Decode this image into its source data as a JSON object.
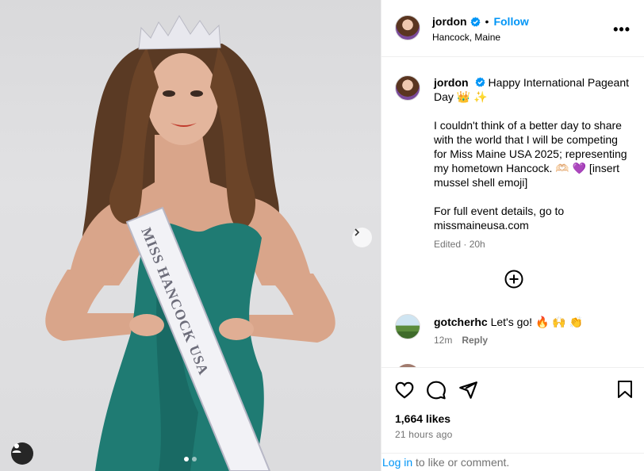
{
  "post": {
    "username": "jordon",
    "follow_label": "Follow",
    "separator": "•",
    "location": "Hancock, Maine",
    "more_label": "•••",
    "caption": {
      "line1": "Happy International Pageant Day 👑 ✨",
      "paragraph2": "I couldn't think of a better day to share with the world that I will be competing for Miss Maine USA 2025; representing my hometown Hancock. 🫶🏻 💜 [insert mussel shell emoji]",
      "paragraph3": "For full event details, go to missmaineusa.com"
    },
    "caption_meta": "Edited · 20h",
    "photo": {
      "sash_text": "MISS HANCOCK USA",
      "carousel_total": 2,
      "carousel_current": 1
    }
  },
  "comments": [
    {
      "username": "gotcherhc",
      "text": "Let's go! 🔥 🙌 👏",
      "time": "12m",
      "reply_label": "Reply"
    }
  ],
  "engagement": {
    "likes": "1,664 likes",
    "time_ago": "21 hours ago"
  },
  "login": {
    "link_label": "Log in",
    "text": " to like or comment."
  },
  "icons": {
    "verified": "verified-badge-icon",
    "like": "heart-icon",
    "comment": "comment-bubble-icon",
    "share": "paper-plane-icon",
    "save": "bookmark-icon",
    "add_comment": "plus-circle-icon",
    "carousel_next": "chevron-right-icon",
    "tagged": "user-tag-icon"
  },
  "colors": {
    "accent": "#0095f6",
    "verified": "#0095f6",
    "muted_text": "#737373",
    "border": "#efefef"
  }
}
